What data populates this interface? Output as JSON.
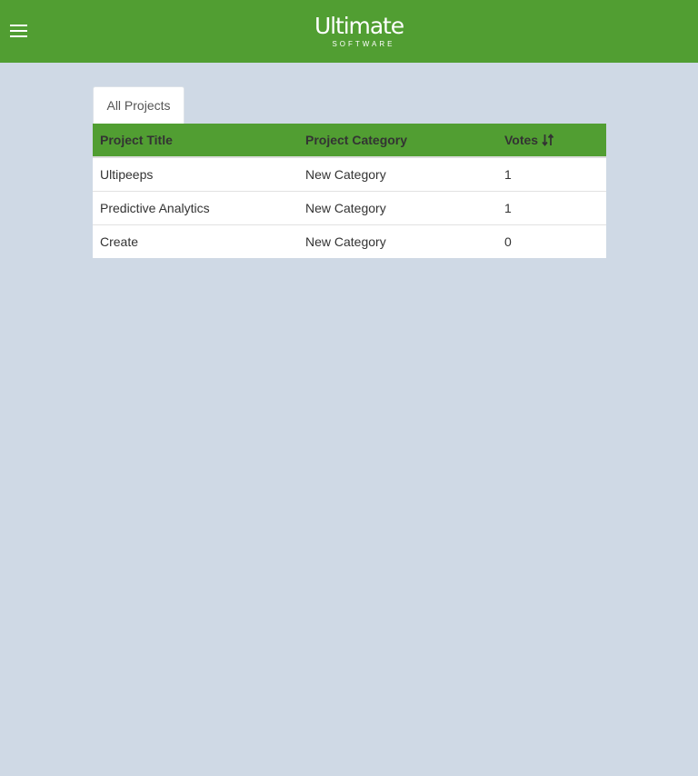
{
  "header": {
    "logo_word": "Ultimate",
    "logo_sub": "SOFTWARE",
    "menu_icon": "hamburger-icon",
    "bg_color": "#519e32"
  },
  "tabs": [
    {
      "label": "All Projects",
      "active": true
    }
  ],
  "table": {
    "columns": [
      "Project Title",
      "Project Category",
      "Votes"
    ],
    "sort_icon": "sort-icon",
    "rows": [
      {
        "title": "Ultipeeps",
        "category": "New Category",
        "votes": "1"
      },
      {
        "title": "Predictive Analytics",
        "category": "New Category",
        "votes": "1"
      },
      {
        "title": "Create",
        "category": "New Category",
        "votes": "0"
      }
    ]
  },
  "colors": {
    "page_bg": "#cfd9e5",
    "accent": "#519e32"
  }
}
